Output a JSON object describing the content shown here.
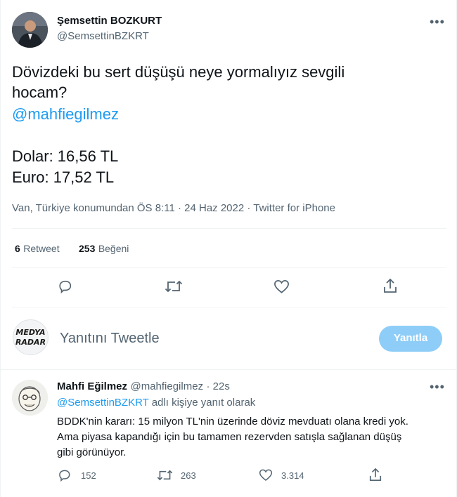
{
  "tweet": {
    "author": {
      "name": "Şemsettin BOZKURT",
      "handle": "@SemsettinBZKRT"
    },
    "text_line1": "Dövizdeki bu sert düşüşü neye yormalıyız sevgili",
    "text_line2": "hocam?",
    "mention": "@mahfiegilmez",
    "dolar": "Dolar: 16,56 TL",
    "euro": "Euro: 17,52 TL",
    "meta": "Van, Türkiye konumundan ÖS 8:11 · 24 Haz 2022 · Twitter for iPhone",
    "stats": {
      "retweet_count": "6",
      "retweet_label": "Retweet",
      "like_count": "253",
      "like_label": "Beğeni"
    }
  },
  "compose": {
    "avatar_line1": "MEDYA",
    "avatar_line2": "RADAR",
    "placeholder": "Yanıtını Tweetle",
    "button_label": "Yanıtla"
  },
  "reply": {
    "author": {
      "name": "Mahfi Eğilmez",
      "handle": "@mahfiegilmez",
      "time": "· 22s"
    },
    "replying_mention": "@SemsettinBZKRT",
    "replying_suffix": " adlı kişiye yanıt olarak",
    "line1": "BDDK'nin kararı: 15 milyon TL'nin üzerinde döviz mevduatı olana kredi yok.",
    "line2": "Ama piyasa kapandığı için bu tamamen rezervden satışla sağlanan düşüş",
    "line3": "gibi görünüyor.",
    "counts": {
      "replies": "152",
      "retweets": "263",
      "likes": "3.314"
    }
  },
  "colors": {
    "accent": "#1d9bf0",
    "muted": "#536471",
    "button_disabled": "#8ecdf8"
  }
}
